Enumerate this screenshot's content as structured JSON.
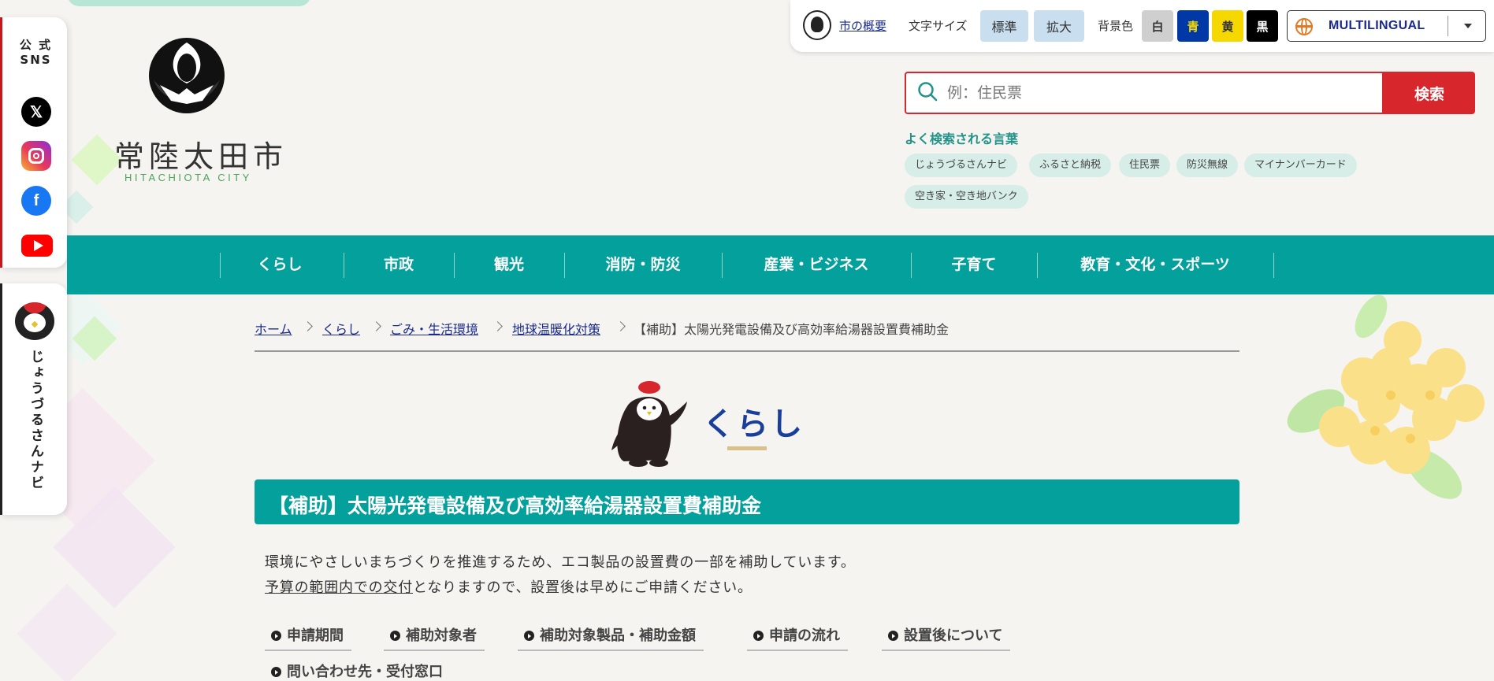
{
  "sns": {
    "title": "公式\nSNS",
    "icons": [
      "x-icon",
      "instagram-icon",
      "facebook-icon",
      "youtube-icon"
    ]
  },
  "navi": {
    "label": "じょうづるさんナビ"
  },
  "logo": {
    "name": "常陸太田市",
    "sub": "HITACHIOTA CITY"
  },
  "util": {
    "overview_link": "市の概要",
    "font_size_label": "文字サイズ",
    "size_standard": "標準",
    "size_large": "拡大",
    "bg_label": "背景色",
    "bg_white": "白",
    "bg_blue": "青",
    "bg_yellow": "黄",
    "bg_black": "黒",
    "language": "MULTILINGUAL"
  },
  "search": {
    "placeholder": "例：住民票",
    "button": "検索",
    "popular_title": "よく検索される言葉",
    "popular": [
      "じょうづるさんナビ",
      "ふるさと納税",
      "住民票",
      "防災無線",
      "マイナンバーカード",
      "空き家・空き地バンク"
    ]
  },
  "gnav": [
    "くらし",
    "市政",
    "観光",
    "消防・防災",
    "産業・ビジネス",
    "子育て",
    "教育・文化・スポーツ"
  ],
  "breadcrumb": {
    "links": [
      "ホーム",
      "くらし",
      "ごみ・生活環境",
      "地球温暖化対策"
    ],
    "current": "【補助】太陽光発電設備及び高効率給湯器設置費補助金"
  },
  "category": {
    "title": "くらし"
  },
  "page": {
    "title": "【補助】太陽光発電設備及び高効率給湯器設置費補助金",
    "intro1": "環境にやさしいまちづくりを推進するため、エコ製品の設置費の一部を補助しています。",
    "intro2_link": "予算の範囲内での交付",
    "intro2_rest": "となりますので、設置後は早めにご申請ください。"
  },
  "anchors": [
    "申請期間",
    "補助対象者",
    "補助対象製品・補助金額",
    "申請の流れ",
    "設置後について",
    "問い合わせ先・受付窓口"
  ],
  "colors": {
    "teal": "#04a09b",
    "red": "#d8262d",
    "navy": "#1a2a8c",
    "bg_blue": "#0039a6",
    "bg_yellow": "#f5d800"
  }
}
